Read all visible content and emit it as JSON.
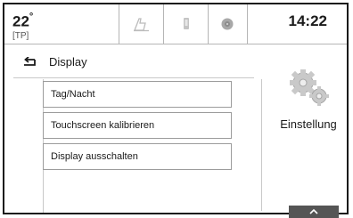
{
  "status": {
    "temperature": "22",
    "temperature_unit": "°",
    "tp_label": "[TP]",
    "time": "14:22"
  },
  "app_tabs": [
    {
      "icon": "navigation-icon"
    },
    {
      "icon": "phone-icon"
    },
    {
      "icon": "media-icon"
    }
  ],
  "page": {
    "title": "Display",
    "back_icon": "back-arrow-icon"
  },
  "menu": {
    "items": [
      {
        "label": "Tag/Nacht"
      },
      {
        "label": "Touchscreen kalibrieren"
      },
      {
        "label": "Display ausschalten"
      }
    ]
  },
  "side": {
    "settings_label": "Einstellung",
    "settings_icon": "gears-icon"
  },
  "footer": {
    "up_icon": "chevron-up-icon"
  },
  "colors": {
    "text": "#1a1a1a",
    "border": "#9c9c9c",
    "button_dark": "#555555"
  }
}
